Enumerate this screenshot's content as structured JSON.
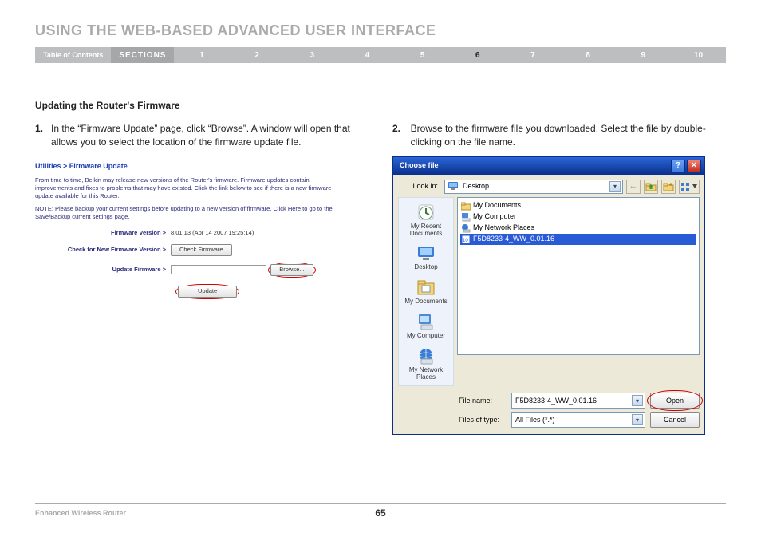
{
  "doc": {
    "title": "USING THE WEB-BASED ADVANCED USER INTERFACE",
    "toc_label": "Table of Contents",
    "sections_label": "SECTIONS",
    "section_numbers": [
      "1",
      "2",
      "3",
      "4",
      "5",
      "6",
      "7",
      "8",
      "9",
      "10"
    ],
    "active_section": "6",
    "subtitle": "Updating the Router's Firmware",
    "step1_num": "1.",
    "step1_text": "In the “Firmware Update” page, click “Browse”. A window will open that allows you to select the location of the firmware update file.",
    "step2_num": "2.",
    "step2_text": "Browse to the firmware file you downloaded. Select the file by double-clicking on the file name.",
    "footer_name": "Enhanced Wireless Router",
    "page_number": "65"
  },
  "firmware": {
    "breadcrumb": "Utilities > Firmware Update",
    "intro": "From time to time, Belkin may release new versions of the Router's firmware. Firmware updates contain improvements and fixes to problems that may have existed. Click the link below to see if there is a new firmware update available for this Router.",
    "note": "NOTE: Please backup your current settings before updating to a new version of firmware. Click Here to go to the Save/Backup current settings page.",
    "labels": {
      "version": "Firmware Version >",
      "check": "Check for New Firmware Version >",
      "update": "Update Firmware >"
    },
    "version_value": "8.01.13 (Apr 14 2007 19:25:14)",
    "check_button": "Check Firmware",
    "browse_button": "Browse...",
    "update_button": "Update"
  },
  "dialog": {
    "title": "Choose file",
    "help_glyph": "?",
    "close_glyph": "✕",
    "lookin_label": "Look in:",
    "lookin_value": "Desktop",
    "toolbar_back": "←",
    "toolbar_up_icon": "up",
    "toolbar_newfolder_icon": "newfolder",
    "toolbar_views_icon": "views",
    "sidebar": {
      "recent": "My Recent Documents",
      "desktop": "Desktop",
      "mydocs": "My Documents",
      "mycomp": "My Computer",
      "netplaces": "My Network Places"
    },
    "files": [
      {
        "icon": "folder",
        "name": "My Documents",
        "selected": false
      },
      {
        "icon": "computer",
        "name": "My Computer",
        "selected": false
      },
      {
        "icon": "network",
        "name": "My Network Places",
        "selected": false
      },
      {
        "icon": "binary",
        "name": "F5D8233-4_WW_0.01.16",
        "selected": true
      }
    ],
    "filename_label": "File name:",
    "filename_value": "F5D8233-4_WW_0.01.16",
    "filetype_label": "Files of type:",
    "filetype_value": "All Files (*.*)",
    "open_label": "Open",
    "cancel_label": "Cancel"
  }
}
